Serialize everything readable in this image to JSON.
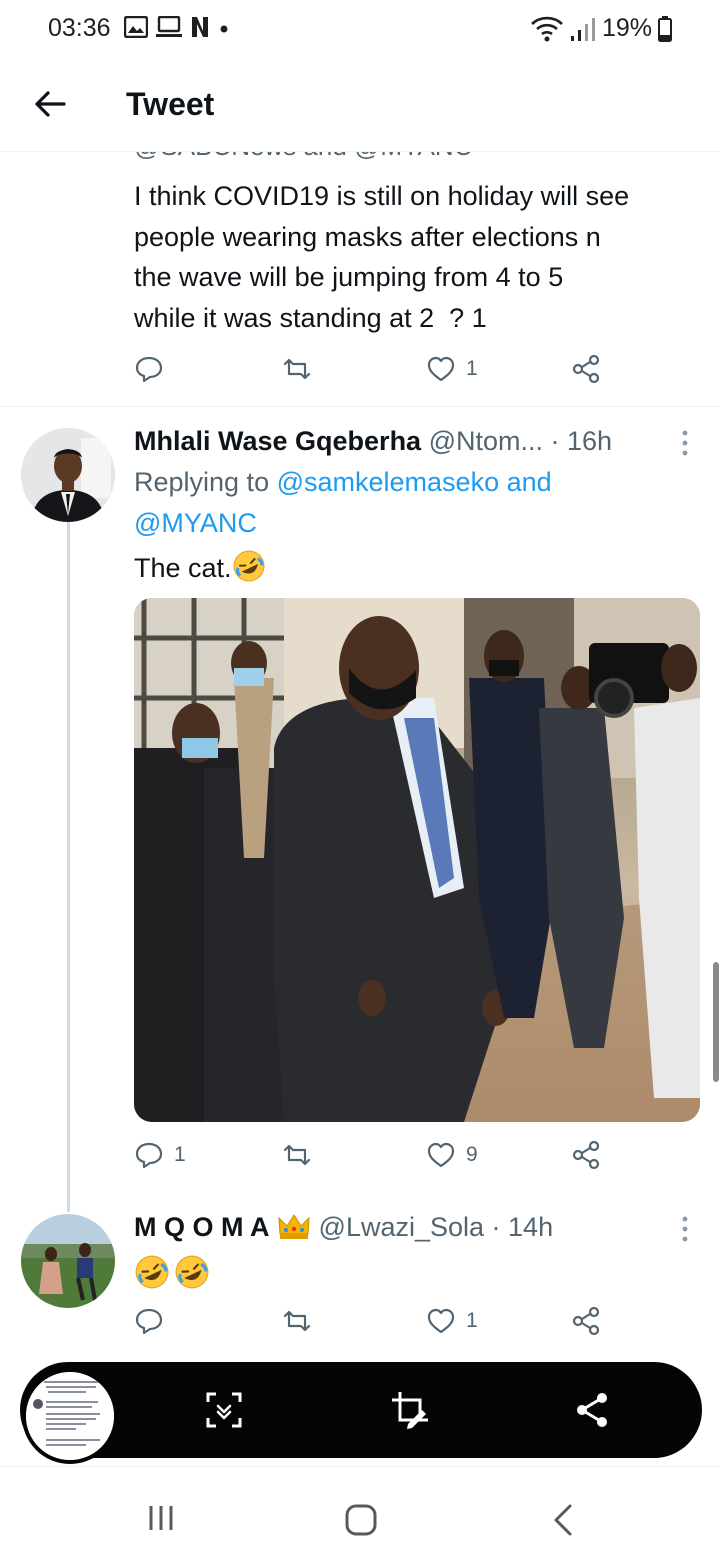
{
  "status": {
    "time": "03:36",
    "battery": "19%",
    "left_icons": [
      "gallery-icon",
      "cast-icon",
      "netflix-icon",
      "dot-icon"
    ],
    "right_icons": [
      "wifi-icon",
      "signal-icon",
      "battery-icon"
    ]
  },
  "header": {
    "title": "Tweet",
    "back_icon": "arrow-left-icon"
  },
  "tweets": [
    {
      "cut_text": "@SABCNews and @MYANC",
      "text_lines": [
        "I think COVID19 is still on holiday will see",
        "people wearing masks after elections n",
        "the wave will be jumping from 4 to 5",
        "while it was standing at 2  ? 1"
      ],
      "actions": {
        "replies": "",
        "retweets": "",
        "likes": "1"
      }
    },
    {
      "name": "Mhlali Wase Gqeberha",
      "handle": "@Ntom...",
      "time": "· 16h",
      "replying_prefix": "Replying to ",
      "replying_user1": "@samkelemaseko",
      "replying_and": " and",
      "replying_user2": "@MYANC",
      "text": "The cat.",
      "emoji": "rofl-emoji",
      "actions": {
        "replies": "1",
        "retweets": "",
        "likes": "9"
      }
    },
    {
      "name": "M Q O M A",
      "name_emoji": "crown-emoji",
      "handle": "@Lwazi_Sola",
      "time": "· 14h",
      "emojis": [
        "rofl-emoji",
        "rofl-emoji"
      ],
      "actions": {
        "replies": "",
        "retweets": "",
        "likes": "1"
      }
    }
  ],
  "toolbar": {
    "buttons": [
      "scroll-capture-icon",
      "crop-edit-icon",
      "share-icon"
    ]
  },
  "navbar": {
    "buttons": [
      "recents-icon",
      "home-icon",
      "back-icon"
    ]
  },
  "colors": {
    "text": "#0f1419",
    "secondary": "#536471",
    "link": "#1d9bf0",
    "divider": "#eef1f3"
  }
}
